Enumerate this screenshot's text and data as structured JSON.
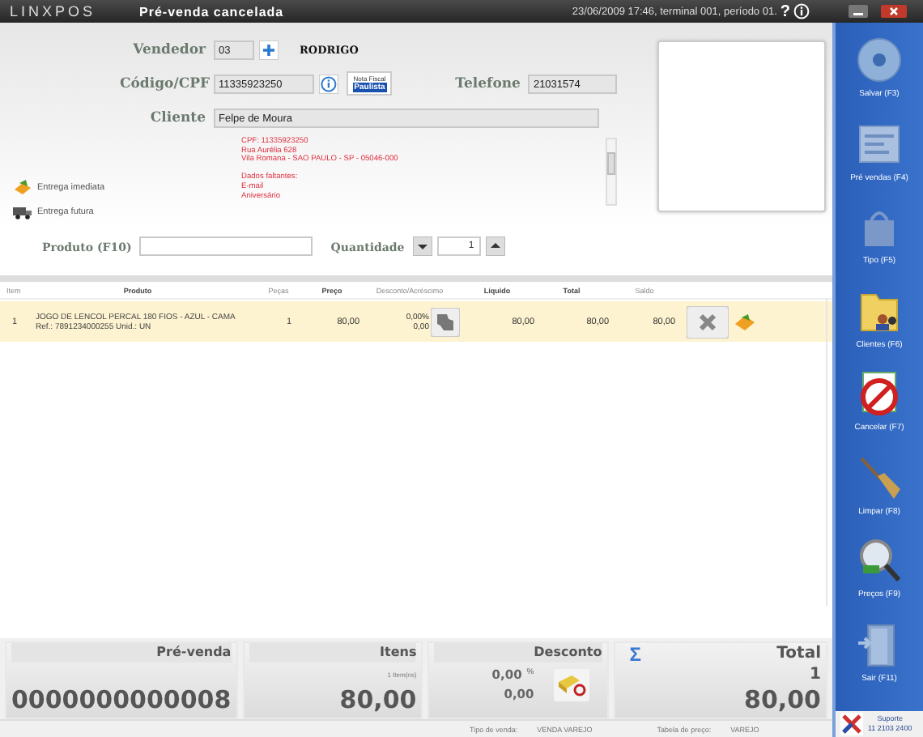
{
  "title_bar": {
    "app_name": "LINXPOS",
    "status": "Pré-venda cancelada",
    "info": "23/06/2009 17:46, terminal 001, período 01.",
    "help": "?"
  },
  "form": {
    "vendedor": {
      "label": "Vendedor",
      "code": "03",
      "name": "RODRIGO"
    },
    "codigo": {
      "label": "Código/CPF",
      "value": "11335923250",
      "badge_top": "Nota Fiscal",
      "badge_bottom": "Paulista"
    },
    "telefone": {
      "label": "Telefone",
      "value": "21031574"
    },
    "cliente": {
      "label": "Cliente",
      "value": "Felpe de Moura"
    },
    "details": [
      [
        "CPF: 11335923250",
        "Rua Aurélia 628",
        "Vila Romana - SAO PAULO - SP - 05046-000"
      ],
      [
        "Dados faltantes:",
        "E-mail",
        "Aniversário"
      ]
    ]
  },
  "delivery": [
    {
      "label": "Entrega imediata",
      "kind": "immediate"
    },
    {
      "label": "Entrega futura",
      "kind": "future"
    }
  ],
  "product_search": {
    "label": "Produto (F10)",
    "quantity_label": "Quantidade",
    "quantity": "1"
  },
  "table": {
    "columns": [
      "Item",
      "Produto",
      "Peças",
      "Preço",
      "Desconto/Acréscimo",
      "Líquido",
      "Total",
      "Saldo"
    ],
    "rows": [
      {
        "item": "1",
        "produto": "JOGO DE LENCOL PERCAL 180 FIOS - AZUL - CAMA",
        "ref": "Ref.: 7891234000255 Unid.: UN",
        "pecas": "1",
        "preco": "80,00",
        "desconto_pct": "0,00%",
        "desconto": "0,00",
        "liquido": "80,00",
        "total": "80,00",
        "saldo": "80,00"
      }
    ]
  },
  "summary": {
    "pre_venda": {
      "label": "Pré-venda",
      "value": "0000000000008"
    },
    "itens": {
      "label": "Itens",
      "note": "1 Item(ns)",
      "value": "80,00"
    },
    "desconto": {
      "label": "Desconto",
      "pct": "0,00",
      "pct_sign": "%",
      "value": "0,00"
    },
    "total": {
      "label": "Total",
      "sigma": "Σ",
      "count": "1",
      "value": "80,00"
    }
  },
  "status_bar": [
    {
      "label": "Tipo de venda:",
      "value": "VENDA VAREJO"
    },
    {
      "label": "Tabela de preço:",
      "value": "VAREJO"
    }
  ],
  "sidebar": [
    {
      "label": "Salvar (F3)",
      "kind": "disc"
    },
    {
      "label": "Pré vendas (F4)",
      "kind": "doc"
    },
    {
      "label": "Tipo (F5)",
      "kind": "bag"
    },
    {
      "label": "Clientes (F6)",
      "kind": "folder"
    },
    {
      "label": "Cancelar (F7)",
      "kind": "cancel"
    },
    {
      "label": "Limpar (F8)",
      "kind": "broom"
    },
    {
      "label": "Preços (F9)",
      "kind": "magnifier"
    },
    {
      "label": "Sair (F11)",
      "kind": "door"
    }
  ],
  "support": {
    "label": "Suporte",
    "phone": "11 2103 2400"
  }
}
